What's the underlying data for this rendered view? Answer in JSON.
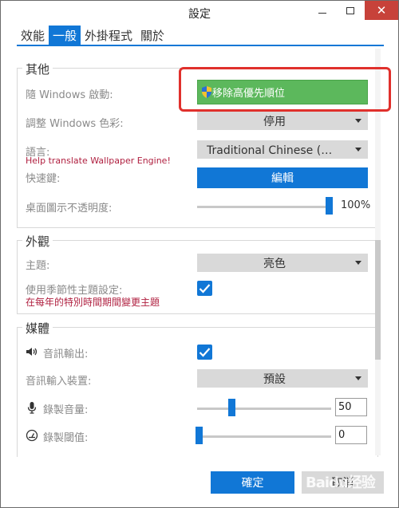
{
  "window": {
    "title": "設定",
    "minimize_symbol": "",
    "close_symbol": "✕"
  },
  "tabs": [
    {
      "label": "效能",
      "active": false
    },
    {
      "label": "一般",
      "active": true
    },
    {
      "label": "外掛程式",
      "active": false
    },
    {
      "label": "關於",
      "active": false
    }
  ],
  "groups": {
    "other": {
      "title": "其他",
      "startup_label": "隨 Windows 啟動:",
      "startup_button": "移除高優先順位",
      "color_label": "調整 Windows 色彩:",
      "color_value": "停用",
      "language_label": "語言:",
      "language_value": "Traditional Chinese (繁…",
      "translate_note": "Help translate Wallpaper Engine!",
      "hotkey_label": "快速鍵:",
      "hotkey_button": "編輯",
      "opacity_label": "桌面圖示不透明度:",
      "opacity_value": "100%",
      "opacity_fraction": 1.0
    },
    "appearance": {
      "title": "外觀",
      "theme_label": "主題:",
      "theme_value": "亮色",
      "seasonal_label": "使用季節性主題設定:",
      "seasonal_note": "在每年的特別時間期間變更主題",
      "seasonal_checked": true
    },
    "media": {
      "title": "媒體",
      "audio_output_label": "音訊輸出:",
      "audio_output_checked": true,
      "audio_input_label": "音訊輸入裝置:",
      "audio_input_value": "預設",
      "record_volume_label": "錄製音量:",
      "record_volume_value": "50",
      "record_volume_fraction": 0.25,
      "record_threshold_label": "錄製閾值:",
      "record_threshold_value": "0",
      "record_threshold_fraction": 0.0
    }
  },
  "footer": {
    "ok_label": "確定",
    "cancel_label": "取消",
    "watermark": "Baidu经验"
  },
  "colors": {
    "accent": "#1177d6",
    "green": "#5cb85c",
    "highlight": "#e0302c",
    "note": "#b02040"
  }
}
